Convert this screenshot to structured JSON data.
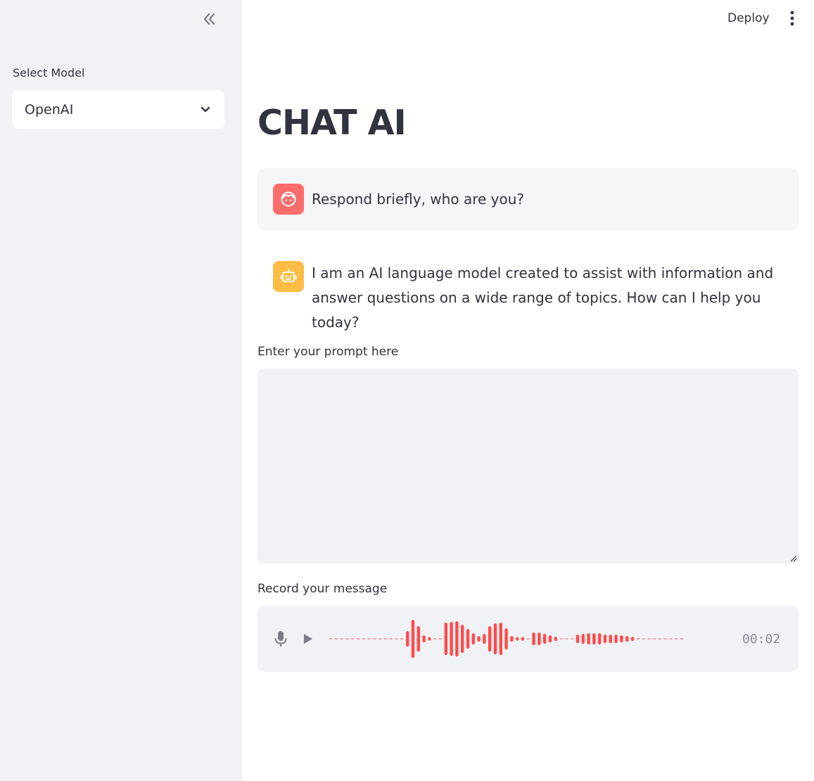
{
  "sidebar": {
    "collapse_icon": "double-chevron-left-icon",
    "select_label": "Select Model",
    "select_value": "OpenAI",
    "select_icon": "chevron-down-icon"
  },
  "header": {
    "deploy_label": "Deploy",
    "menu_icon": "vertical-dots-icon"
  },
  "main": {
    "title": "CHAT AI",
    "messages": [
      {
        "role": "user",
        "avatar_icon": "smiley-face-icon",
        "avatar_color": "#ff6c6c",
        "text": "Respond briefly, who are you?"
      },
      {
        "role": "assistant",
        "avatar_icon": "robot-icon",
        "avatar_color": "#ffbd45",
        "text": "I am an AI language model created to assist with information and answer questions on a wide range of topics. How can I help you today?"
      }
    ],
    "prompt_label": "Enter your prompt here",
    "prompt_value": "",
    "record_label": "Record your message",
    "recorder": {
      "mic_icon": "microphone-icon",
      "play_icon": "play-icon",
      "timer": "00:02",
      "wave_color": "#ff4b4b"
    }
  }
}
